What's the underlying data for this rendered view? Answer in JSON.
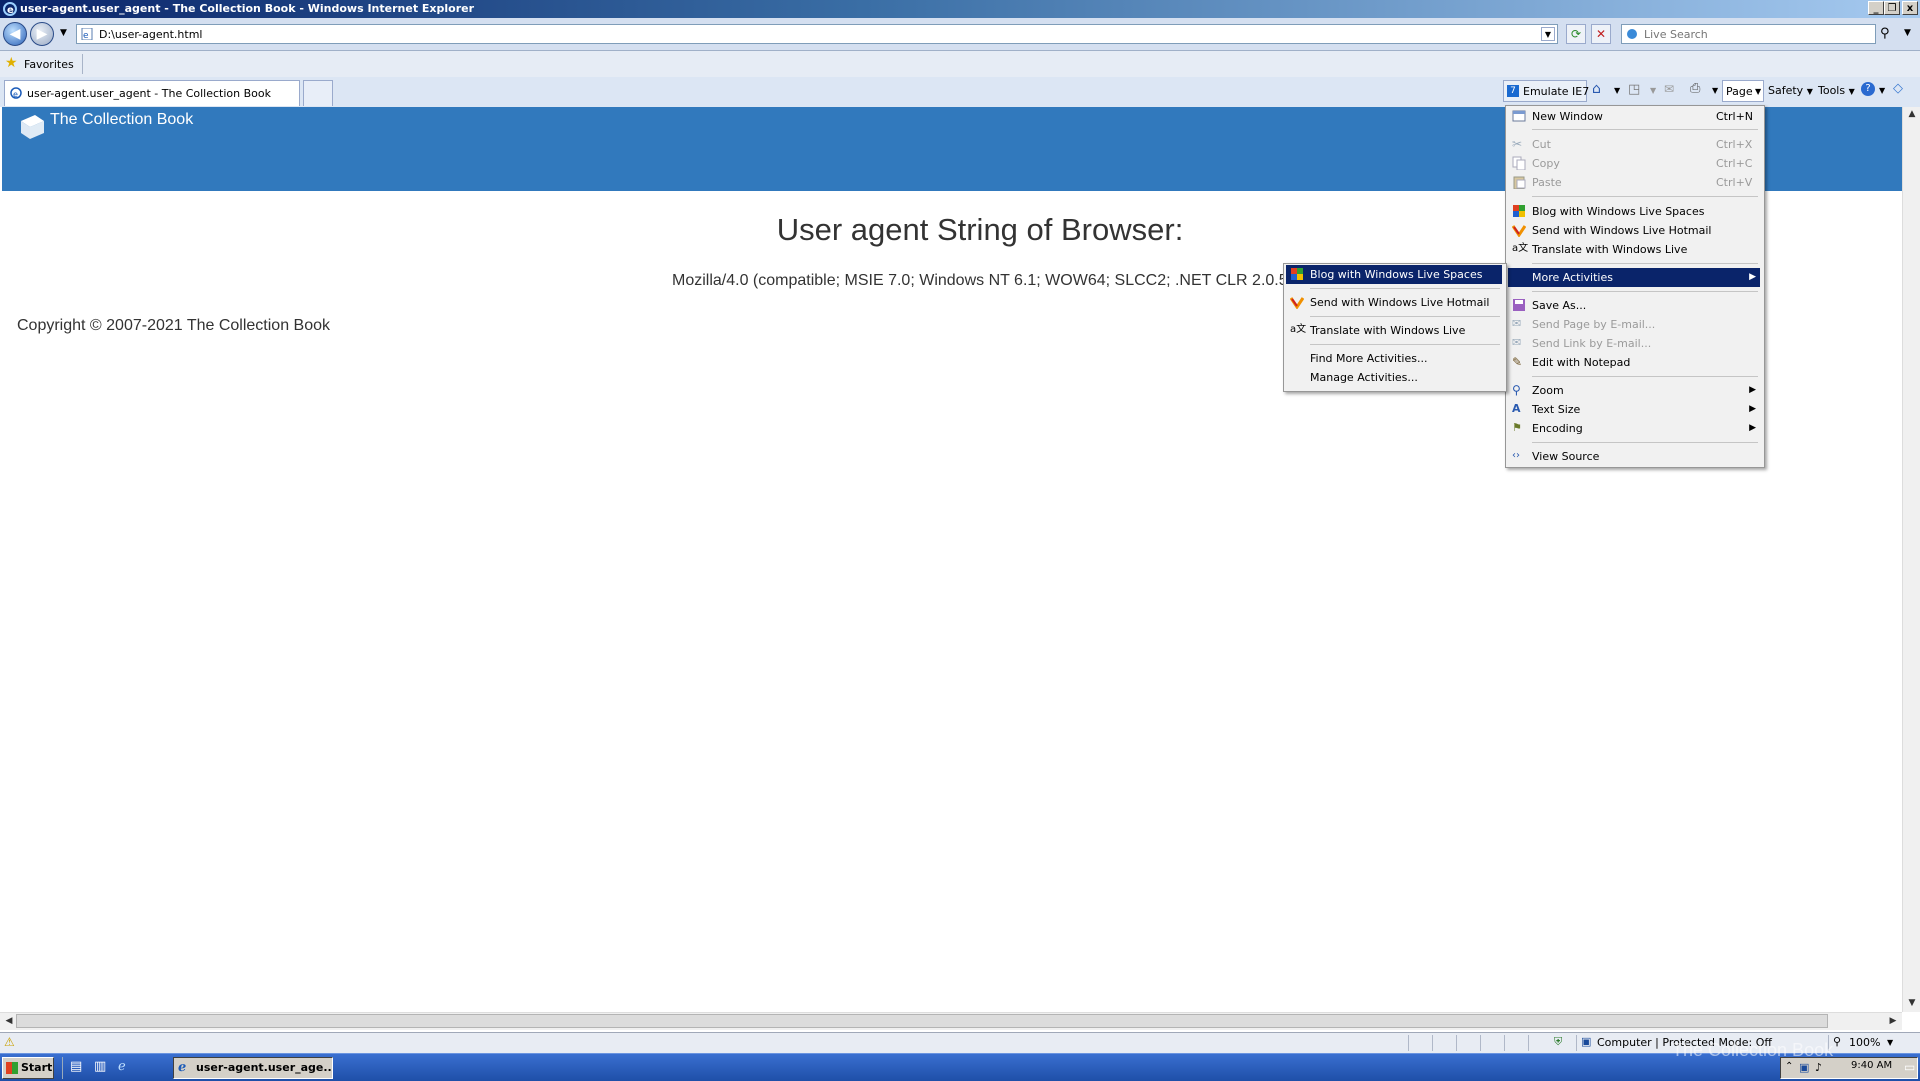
{
  "window": {
    "title": "user-agent.user_agent - The Collection Book - Windows Internet Explorer",
    "minimize": "_",
    "restore": "❐",
    "close": "x"
  },
  "address_bar": {
    "url": "D:\\user-agent.html",
    "search_placeholder": "Live Search"
  },
  "favorites_bar": {
    "label": "Favorites"
  },
  "tabs": [
    {
      "label": "user-agent.user_agent - The Collection Book"
    }
  ],
  "command_bar": {
    "emulate": "Emulate IE7",
    "page": "Page",
    "safety": "Safety",
    "tools": "Tools"
  },
  "page": {
    "site_name": "The Collection Book",
    "heading": "User agent String of Browser:",
    "ua_string": "Mozilla/4.0 (compatible; MSIE 7.0; Windows NT 6.1; WOW64; SLCC2; .NET CLR 2.0.50727",
    "copyright": "Copyright © 2007-2021 The Collection Book",
    "banner_color": "#3179bd"
  },
  "page_menu": {
    "items": [
      {
        "label": "New Window",
        "shortcut": "Ctrl+N",
        "icon": "window-icon"
      },
      {
        "label": "Cut",
        "shortcut": "Ctrl+X",
        "icon": "scissors-icon",
        "disabled": true
      },
      {
        "label": "Copy",
        "shortcut": "Ctrl+C",
        "icon": "copy-icon",
        "disabled": true
      },
      {
        "label": "Paste",
        "shortcut": "Ctrl+V",
        "icon": "paste-icon",
        "disabled": true
      },
      {
        "label": "Blog with Windows Live Spaces",
        "icon": "windows-live-icon"
      },
      {
        "label": "Send with Windows Live Hotmail",
        "icon": "hotmail-icon"
      },
      {
        "label": "Translate with Windows Live",
        "icon": "translate-icon"
      },
      {
        "label": "More Activities",
        "highlighted": true
      },
      {
        "label": "Save As...",
        "icon": "save-icon"
      },
      {
        "label": "Send Page by E-mail...",
        "icon": "email-icon",
        "disabled": true
      },
      {
        "label": "Send Link by E-mail...",
        "icon": "email-link-icon",
        "disabled": true
      },
      {
        "label": "Edit with Notepad",
        "icon": "pencil-icon"
      },
      {
        "label": "Zoom",
        "icon": "zoom-icon"
      },
      {
        "label": "Text Size",
        "icon": "text-size-icon"
      },
      {
        "label": "Encoding",
        "icon": "encoding-icon"
      },
      {
        "label": "View Source",
        "icon": "view-source-icon"
      }
    ]
  },
  "activities_menu": {
    "items": [
      {
        "label": "Blog with Windows Live Spaces",
        "highlighted": true
      },
      {
        "label": "Send with Windows Live Hotmail"
      },
      {
        "label": "Translate with Windows Live"
      },
      {
        "label": "Find More Activities..."
      },
      {
        "label": "Manage Activities..."
      }
    ]
  },
  "status_bar": {
    "zone": "Computer | Protected Mode: Off",
    "zoom": "100%"
  },
  "taskbar": {
    "start": "Start",
    "active_task": "user-agent.user_age...",
    "clock": "9:40 AM"
  },
  "watermark": "The Collection Book"
}
